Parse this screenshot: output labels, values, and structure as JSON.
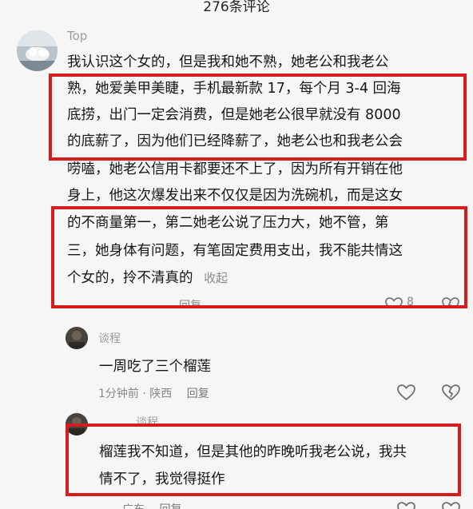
{
  "header": {
    "title": "276条评论"
  },
  "top_comment": {
    "author": "Top",
    "lines": [
      "我认识这个女的，但是我和她不熟，她老公和我老公",
      "熟，她爱美甲美睫，手机最新款 17，每个月 3-4 回海",
      "底捞，出门一定会消费，但是她老公很早就没有 8000",
      "的底薪了，因为他们已经降薪了，她老公也和我老公会",
      "唠嗑，她老公信用卡都要还不上了，因为所有开销在他",
      "身上，他这次爆发出来不仅仅是因为洗碗机，而是这女",
      "的不商量第一，第二她老公说了压力大，她不管，第",
      "三，她身体有问题，有笔固定费用支出，我不能共情这"
    ],
    "last_line": "个女的，拎不清真的",
    "collapse_label": "收起",
    "like_count": "8",
    "reply_label": "回复"
  },
  "reply1": {
    "author": "谈程",
    "text": "一周吃了三个榴莲",
    "time": "1分钟前",
    "location": "陕西",
    "reply_label": "回复"
  },
  "reply2": {
    "author": "谈程",
    "lines": [
      "榴莲我不知道，但是其他的昨晚听我老公说，我共",
      "情不了，我觉得挺作"
    ],
    "location": "广东",
    "reply_label": "回复"
  },
  "colors": {
    "highlight": "#d51d1d",
    "background": "#f6f6f6"
  }
}
